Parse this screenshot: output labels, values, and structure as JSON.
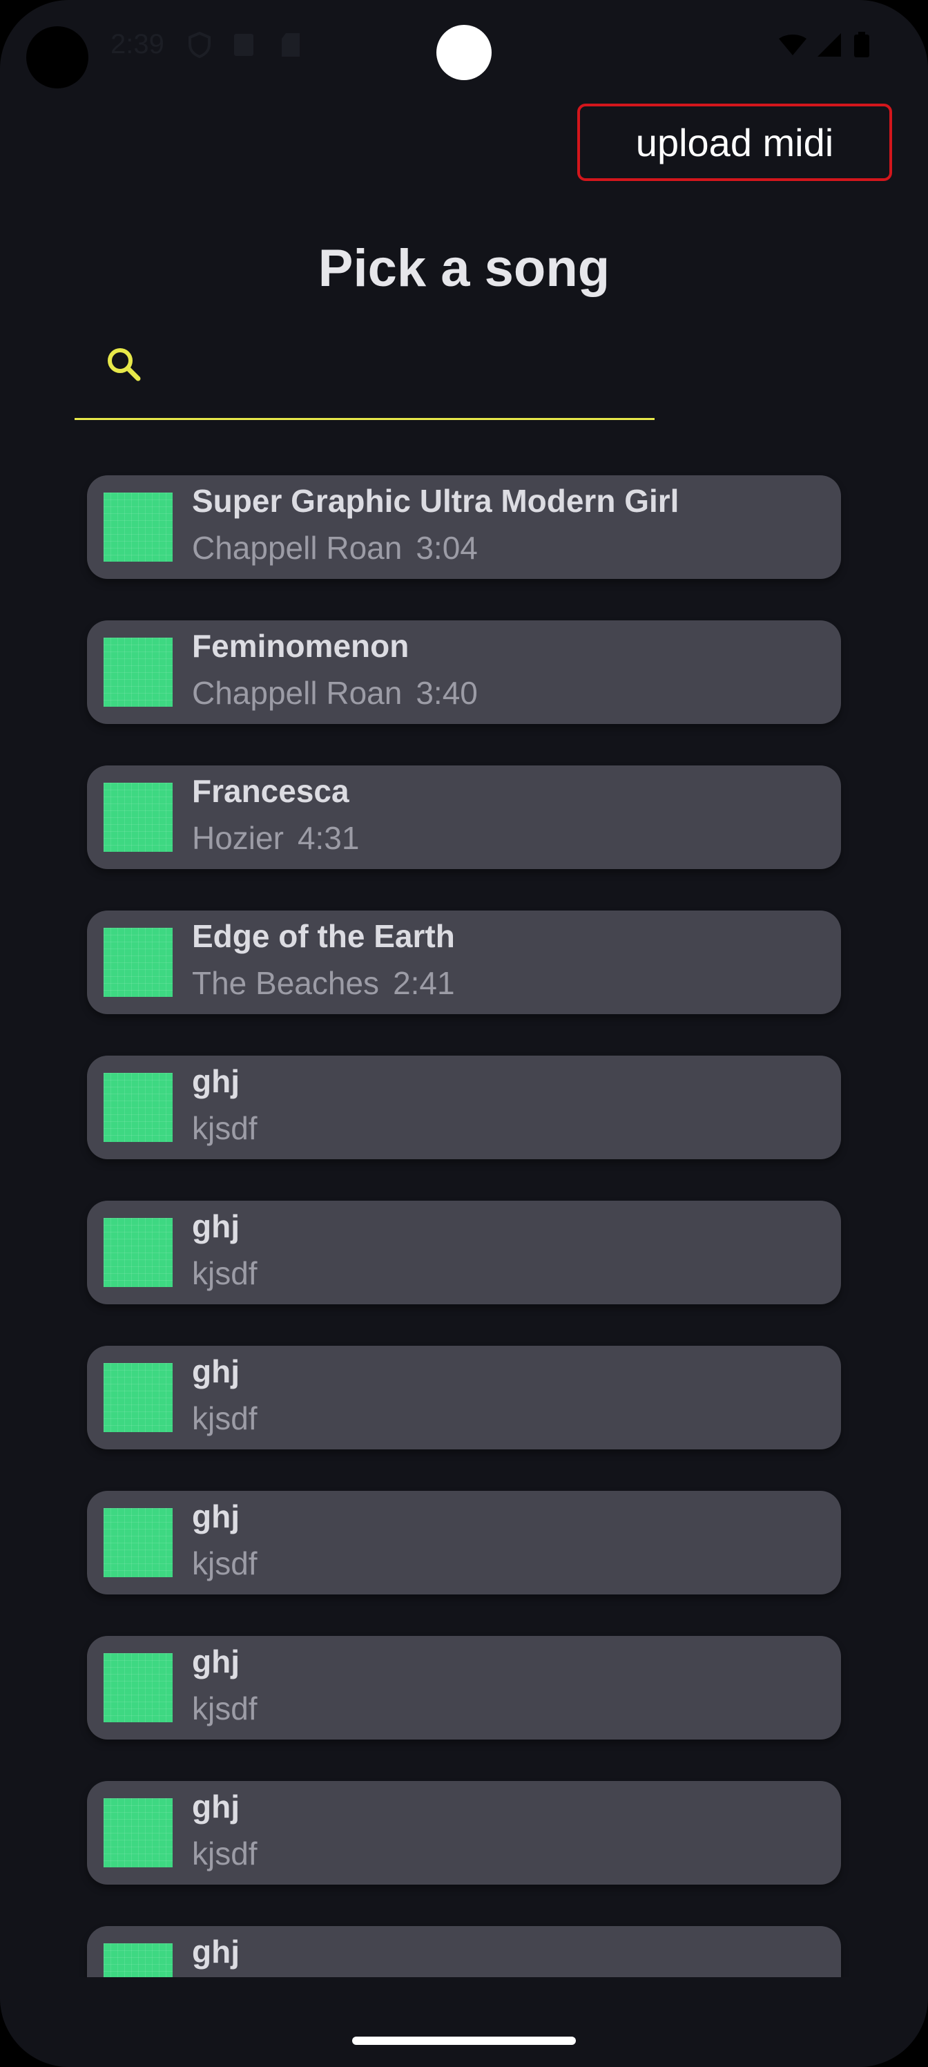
{
  "status_bar": {
    "time": "2:39",
    "icons": [
      "shield-icon",
      "font-icon",
      "sd-card-icon",
      "wifi-icon",
      "signal-icon",
      "battery-icon"
    ]
  },
  "header": {
    "upload_label": "upload midi",
    "title": "Pick a song"
  },
  "search": {
    "placeholder": "",
    "value": "",
    "icon": "search-icon",
    "accent_color": "#e7e84a"
  },
  "songs": [
    {
      "title": "Super Graphic Ultra Modern Girl",
      "artist": "Chappell Roan",
      "duration": "3:04"
    },
    {
      "title": "Feminomenon",
      "artist": "Chappell Roan",
      "duration": "3:40"
    },
    {
      "title": "Francesca",
      "artist": "Hozier",
      "duration": "4:31"
    },
    {
      "title": "Edge of the Earth",
      "artist": "The Beaches",
      "duration": "2:41"
    },
    {
      "title": "ghj",
      "artist": "kjsdf",
      "duration": ""
    },
    {
      "title": "ghj",
      "artist": "kjsdf",
      "duration": ""
    },
    {
      "title": "ghj",
      "artist": "kjsdf",
      "duration": ""
    },
    {
      "title": "ghj",
      "artist": "kjsdf",
      "duration": ""
    },
    {
      "title": "ghj",
      "artist": "kjsdf",
      "duration": ""
    },
    {
      "title": "ghj",
      "artist": "kjsdf",
      "duration": ""
    },
    {
      "title": "ghj",
      "artist": "",
      "duration": ""
    }
  ],
  "colors": {
    "background": "#121319",
    "card": "#45454f",
    "thumbnail": "#3ed882",
    "upload_border": "#d3161c"
  }
}
